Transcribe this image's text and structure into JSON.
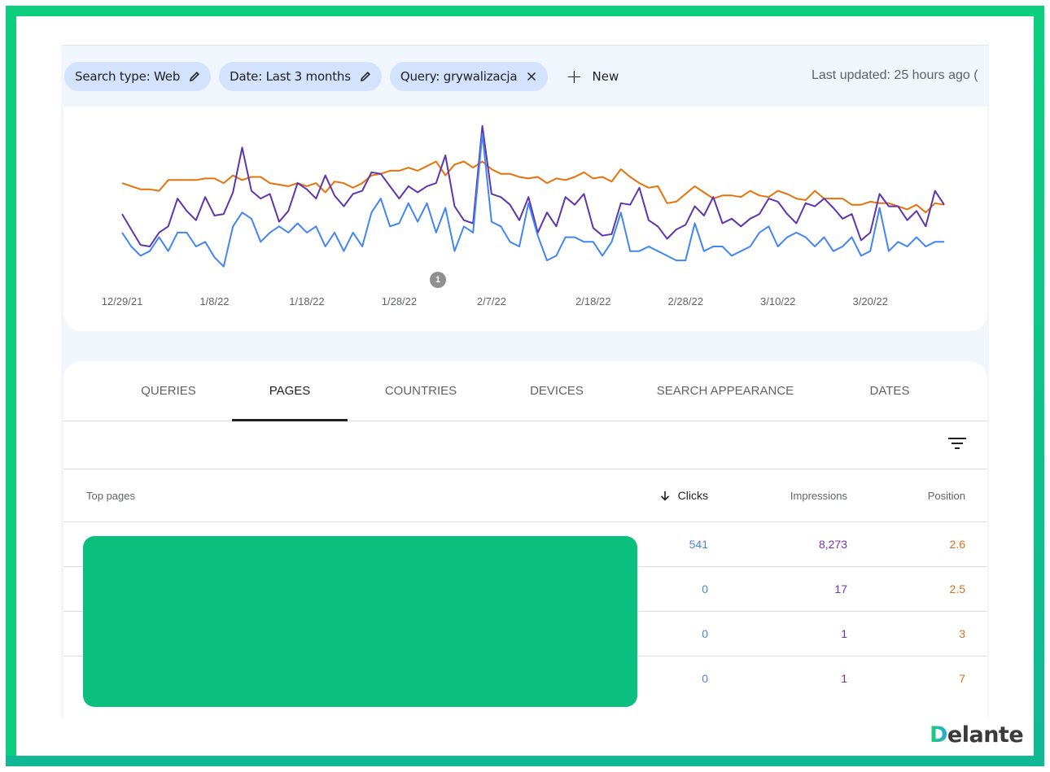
{
  "filters": {
    "chips": [
      {
        "label": "Search type: Web",
        "icon": "pencil-icon"
      },
      {
        "label": "Date: Last 3 months",
        "icon": "pencil-icon"
      },
      {
        "label": "Query: grywalizacja",
        "icon": "close-icon"
      }
    ],
    "new_label": "New",
    "last_updated": "Last updated: 25 hours ago ("
  },
  "chart_data": {
    "type": "line",
    "title": "",
    "xlabel": "",
    "ylabel": "",
    "y_units": "relative (0-100, axes hidden)",
    "x_start": "12/29/21",
    "x_tick_labels": [
      "12/29/21",
      "1/8/22",
      "1/18/22",
      "1/28/22",
      "2/7/22",
      "2/18/22",
      "2/28/22",
      "3/10/22",
      "3/20/22"
    ],
    "grid": false,
    "annotation": {
      "label": "1",
      "near": "2/2/22"
    },
    "series": [
      {
        "name": "Position",
        "color": "#e8710a",
        "values": [
          61,
          59,
          57,
          57,
          56,
          63,
          63,
          63,
          63,
          64,
          64,
          61,
          66,
          63,
          65,
          65,
          61,
          60,
          59,
          61,
          59,
          61,
          55,
          62,
          61,
          58,
          61,
          66,
          67,
          69,
          69,
          71,
          69,
          72,
          75,
          66,
          73,
          75,
          71,
          75,
          70,
          67,
          67,
          65,
          64,
          65,
          61,
          64,
          63,
          65,
          68,
          64,
          65,
          62,
          70,
          65,
          61,
          58,
          59,
          48,
          49,
          54,
          59,
          55,
          51,
          53,
          53,
          52,
          56,
          53,
          52,
          56,
          54,
          51,
          50,
          56,
          51,
          51,
          51,
          47,
          47,
          49,
          48,
          48,
          46,
          44,
          47,
          42,
          48,
          47
        ]
      },
      {
        "name": "Impressions",
        "color": "#5e35b1",
        "values": [
          41,
          31,
          21,
          20,
          29,
          33,
          51,
          43,
          37,
          52,
          40,
          41,
          55,
          84,
          56,
          51,
          54,
          36,
          43,
          61,
          57,
          51,
          66,
          53,
          46,
          54,
          56,
          68,
          67,
          59,
          51,
          59,
          55,
          59,
          61,
          79,
          46,
          37,
          35,
          98,
          54,
          52,
          47,
          37,
          52,
          29,
          42,
          33,
          52,
          47,
          54,
          32,
          27,
          28,
          48,
          47,
          58,
          37,
          33,
          25,
          31,
          34,
          46,
          40,
          52,
          35,
          38,
          33,
          38,
          41,
          51,
          49,
          41,
          35,
          48,
          46,
          51,
          45,
          38,
          41,
          24,
          29,
          54,
          46,
          46,
          37,
          43,
          33,
          56,
          47
        ]
      },
      {
        "name": "Clicks",
        "color": "#4285f4",
        "values": [
          29,
          20,
          14,
          17,
          26,
          17,
          29,
          29,
          20,
          23,
          13,
          7,
          33,
          42,
          38,
          23,
          29,
          33,
          29,
          35,
          29,
          33,
          20,
          29,
          17,
          29,
          20,
          42,
          51,
          33,
          35,
          48,
          36,
          48,
          29,
          45,
          17,
          33,
          29,
          93,
          36,
          33,
          23,
          20,
          48,
          27,
          11,
          14,
          26,
          26,
          23,
          23,
          14,
          23,
          42,
          17,
          17,
          20,
          17,
          14,
          11,
          11,
          35,
          17,
          20,
          20,
          14,
          17,
          20,
          29,
          33,
          20,
          26,
          29,
          26,
          20,
          26,
          17,
          20,
          26,
          14,
          17,
          45,
          17,
          23,
          20,
          26,
          20,
          23,
          23
        ]
      }
    ]
  },
  "tabs": [
    {
      "label": "QUERIES",
      "active": false
    },
    {
      "label": "PAGES",
      "active": true
    },
    {
      "label": "COUNTRIES",
      "active": false
    },
    {
      "label": "DEVICES",
      "active": false
    },
    {
      "label": "SEARCH APPEARANCE",
      "active": false
    },
    {
      "label": "DATES",
      "active": false
    }
  ],
  "table": {
    "columns": {
      "page": "Top pages",
      "clicks": "Clicks",
      "impressions": "Impressions",
      "position": "Position"
    },
    "sort_icon": "arrow-down-icon",
    "rows": [
      {
        "url": "",
        "clicks": "541",
        "impressions": "8,273",
        "position": "2.6"
      },
      {
        "url": "",
        "clicks": "0",
        "impressions": "17",
        "position": "2.5"
      },
      {
        "url": "",
        "clicks": "0",
        "impressions": "1",
        "position": "3"
      },
      {
        "url": "",
        "clicks": "0",
        "impressions": "1",
        "position": "7"
      }
    ]
  },
  "colors": {
    "clicks": "#4a86d9",
    "impressions": "#7b2fb0",
    "position": "#d4701c",
    "frame": "#0ccf7d",
    "redaction": "#0bc07e"
  },
  "branding": {
    "logo_first": "D",
    "logo_rest": "elante"
  }
}
